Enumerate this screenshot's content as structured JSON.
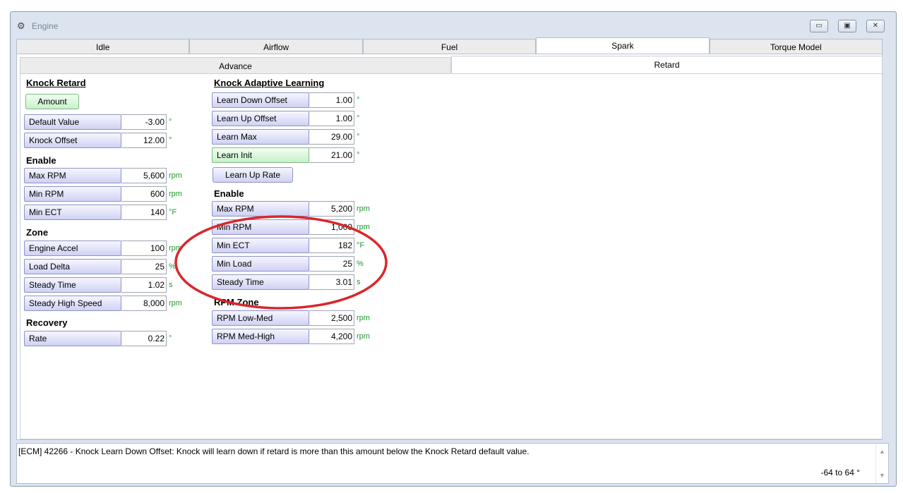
{
  "window": {
    "title": "Engine",
    "buttons": {
      "minimize": "▭",
      "restore": "▣",
      "close": "✕"
    }
  },
  "main_tabs": [
    "Idle",
    "Airflow",
    "Fuel",
    "Spark",
    "Torque Model"
  ],
  "sub_tabs": [
    "Advance",
    "Retard"
  ],
  "knock_retard": {
    "heading": "Knock Retard",
    "amount_button": "Amount",
    "fields": [
      {
        "label": "Default Value",
        "value": "-3.00",
        "unit": "°"
      },
      {
        "label": "Knock Offset",
        "value": "12.00",
        "unit": "°"
      }
    ]
  },
  "enable_left": {
    "heading": "Enable",
    "fields": [
      {
        "label": "Max RPM",
        "value": "5,600",
        "unit": "rpm"
      },
      {
        "label": "Min RPM",
        "value": "600",
        "unit": "rpm"
      },
      {
        "label": "Min ECT",
        "value": "140",
        "unit": "°F"
      }
    ]
  },
  "zone": {
    "heading": "Zone",
    "fields": [
      {
        "label": "Engine Accel",
        "value": "100",
        "unit": "rpm"
      },
      {
        "label": "Load Delta",
        "value": "25",
        "unit": "%"
      },
      {
        "label": "Steady Time",
        "value": "1.02",
        "unit": "s"
      },
      {
        "label": "Steady High Speed",
        "value": "8,000",
        "unit": "rpm"
      }
    ]
  },
  "recovery": {
    "heading": "Recovery",
    "fields": [
      {
        "label": "Rate",
        "value": "0.22",
        "unit": "°"
      }
    ]
  },
  "knock_adaptive": {
    "heading": "Knock Adaptive Learning",
    "fields": [
      {
        "label": "Learn Down Offset",
        "value": "1.00",
        "unit": "°"
      },
      {
        "label": "Learn Up Offset",
        "value": "1.00",
        "unit": "°"
      },
      {
        "label": "Learn Max",
        "value": "29.00",
        "unit": "°"
      },
      {
        "label": "Learn Init",
        "value": "21.00",
        "unit": "°"
      }
    ],
    "learn_up_rate_button": "Learn Up Rate"
  },
  "enable_right": {
    "heading": "Enable",
    "fields": [
      {
        "label": "Max RPM",
        "value": "5,200",
        "unit": "rpm"
      },
      {
        "label": "Min RPM",
        "value": "1,000",
        "unit": "rpm"
      },
      {
        "label": "Min ECT",
        "value": "182",
        "unit": "°F"
      },
      {
        "label": "Min Load",
        "value": "25",
        "unit": "%"
      },
      {
        "label": "Steady Time",
        "value": "3.01",
        "unit": "s"
      }
    ]
  },
  "rpm_zone": {
    "heading": "RPM Zone",
    "fields": [
      {
        "label": "RPM Low-Med",
        "value": "2,500",
        "unit": "rpm"
      },
      {
        "label": "RPM Med-High",
        "value": "4,200",
        "unit": "rpm"
      }
    ]
  },
  "status": {
    "text": "[ECM] 42266 - Knock Learn Down Offset: Knock will learn down if retard is more than this amount below the Knock Retard default value.",
    "range": "-64 to 64 °"
  },
  "colors": {
    "annotation": "#d9262c",
    "unit": "#1f9a2c"
  }
}
